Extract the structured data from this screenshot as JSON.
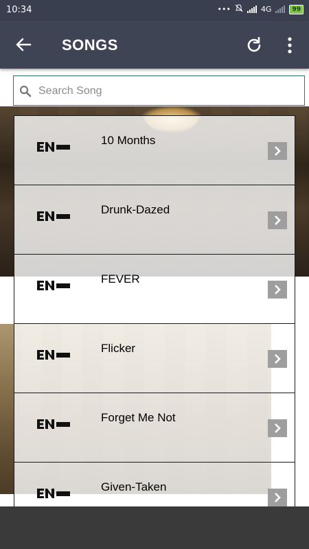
{
  "status_bar": {
    "time": "10:34",
    "network": "4G",
    "battery": "99"
  },
  "app_bar": {
    "title": "SONGS"
  },
  "search": {
    "placeholder": "Search Song",
    "value": ""
  },
  "songs": [
    {
      "title": "10 Months"
    },
    {
      "title": "Drunk-Dazed"
    },
    {
      "title": "FEVER"
    },
    {
      "title": "Flicker"
    },
    {
      "title": "Forget Me Not"
    },
    {
      "title": "Given-Taken"
    }
  ],
  "colors": {
    "app_bar": "#3f4454",
    "status_bar": "#3a3f4f",
    "search_border": "#2f6b74",
    "chevron_button": "#9e9e9e",
    "battery": "#7bc34a"
  },
  "icons": [
    "back-arrow-icon",
    "refresh-icon",
    "more-vert-icon",
    "search-icon",
    "chevron-right-icon",
    "enhypen-logo-icon"
  ]
}
